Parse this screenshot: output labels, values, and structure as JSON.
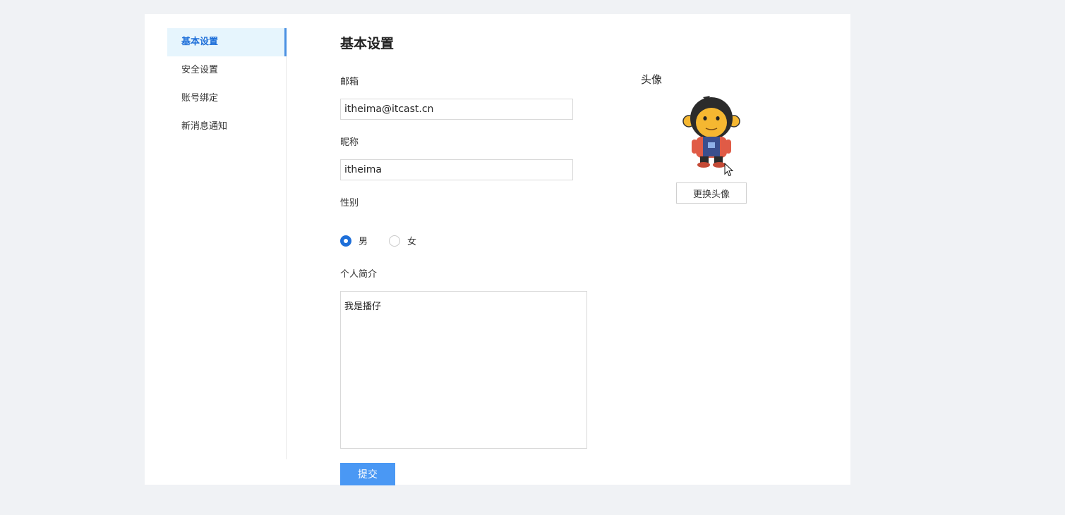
{
  "sidebar": {
    "items": [
      {
        "label": "基本设置",
        "active": true
      },
      {
        "label": "安全设置",
        "active": false
      },
      {
        "label": "账号绑定",
        "active": false
      },
      {
        "label": "新消息通知",
        "active": false
      }
    ]
  },
  "main": {
    "title": "基本设置",
    "email": {
      "label": "邮箱",
      "value": "itheima@itcast.cn"
    },
    "nickname": {
      "label": "昵称",
      "value": "itheima"
    },
    "gender": {
      "label": "性别",
      "options": [
        {
          "label": "男",
          "checked": true
        },
        {
          "label": "女",
          "checked": false
        }
      ]
    },
    "bio": {
      "label": "个人简介",
      "value": "我是播仔"
    },
    "submit_label": "提交"
  },
  "avatar": {
    "label": "头像",
    "icon": "monkey-mascot",
    "change_label": "更换头像"
  },
  "colors": {
    "accent": "#4a98f4",
    "active_bg": "#e6f5fd",
    "page_bg": "#f0f2f5"
  }
}
